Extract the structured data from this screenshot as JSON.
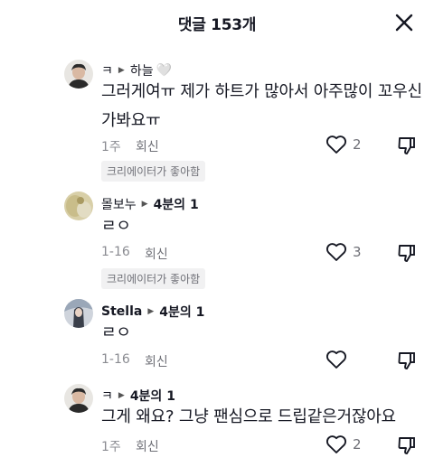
{
  "header": {
    "title": "댓글 153개"
  },
  "comments": [
    {
      "author": "ㅋ",
      "reply_to": "하늘",
      "author_badge": "🤍",
      "text": "그러게여ㅠ 제가 하트가 많아서 아주많이 꼬우신가봐요ㅠ",
      "date": "1주",
      "reply_label": "회신",
      "likes": "2",
      "creator_liked": "크리에이터가 좋아함"
    },
    {
      "author": "몰보누",
      "reply_to": "4분의 1",
      "text": "ㄹㅇ",
      "date": "1-16",
      "reply_label": "회신",
      "likes": "3",
      "creator_liked": "크리에이터가 좋아함"
    },
    {
      "author": "Stella",
      "reply_to": "4분의 1",
      "text": "ㄹㅇ",
      "date": "1-16",
      "reply_label": "회신",
      "likes": ""
    },
    {
      "author": "ㅋ",
      "reply_to": "4분의 1",
      "text": "그게 왜요? 그냥 팬심으로 드립같은거잖아요",
      "date": "1주",
      "reply_label": "회신",
      "likes": "2"
    }
  ],
  "icons": {
    "close": "close-icon",
    "like": "heart-outline-icon",
    "dislike": "thumbs-down-icon",
    "reply_arrow": "triangle-right-icon"
  }
}
